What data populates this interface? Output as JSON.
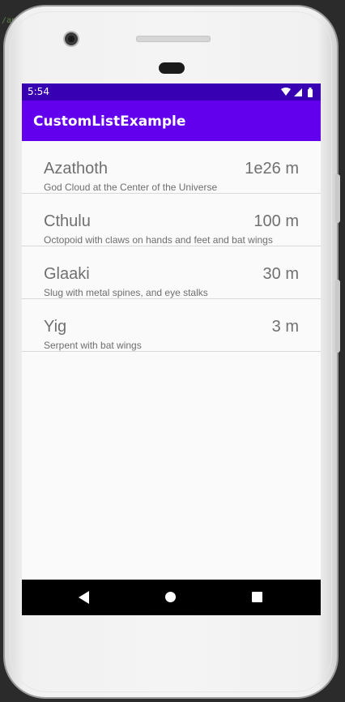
{
  "ide": {
    "snippet": "/an"
  },
  "status_bar": {
    "time": "5:54",
    "icons": [
      "wifi-icon",
      "signal-icon",
      "battery-icon"
    ]
  },
  "app_bar": {
    "title": "CustomListExample",
    "color": "#6200ee",
    "status_color": "#3700b3"
  },
  "list": {
    "items": [
      {
        "name": "Azathoth",
        "size": "1e26 m",
        "description": "God Cloud at the Center of the Universe"
      },
      {
        "name": "Cthulu",
        "size": "100 m",
        "description": "Octopoid with claws on hands and feet and bat wings"
      },
      {
        "name": "Glaaki",
        "size": "30 m",
        "description": "Slug with metal spines, and eye stalks"
      },
      {
        "name": "Yig",
        "size": "3 m",
        "description": "Serpent with bat wings"
      }
    ]
  },
  "nav_bar": {
    "icons": [
      "back-icon",
      "home-icon",
      "recents-icon"
    ]
  }
}
